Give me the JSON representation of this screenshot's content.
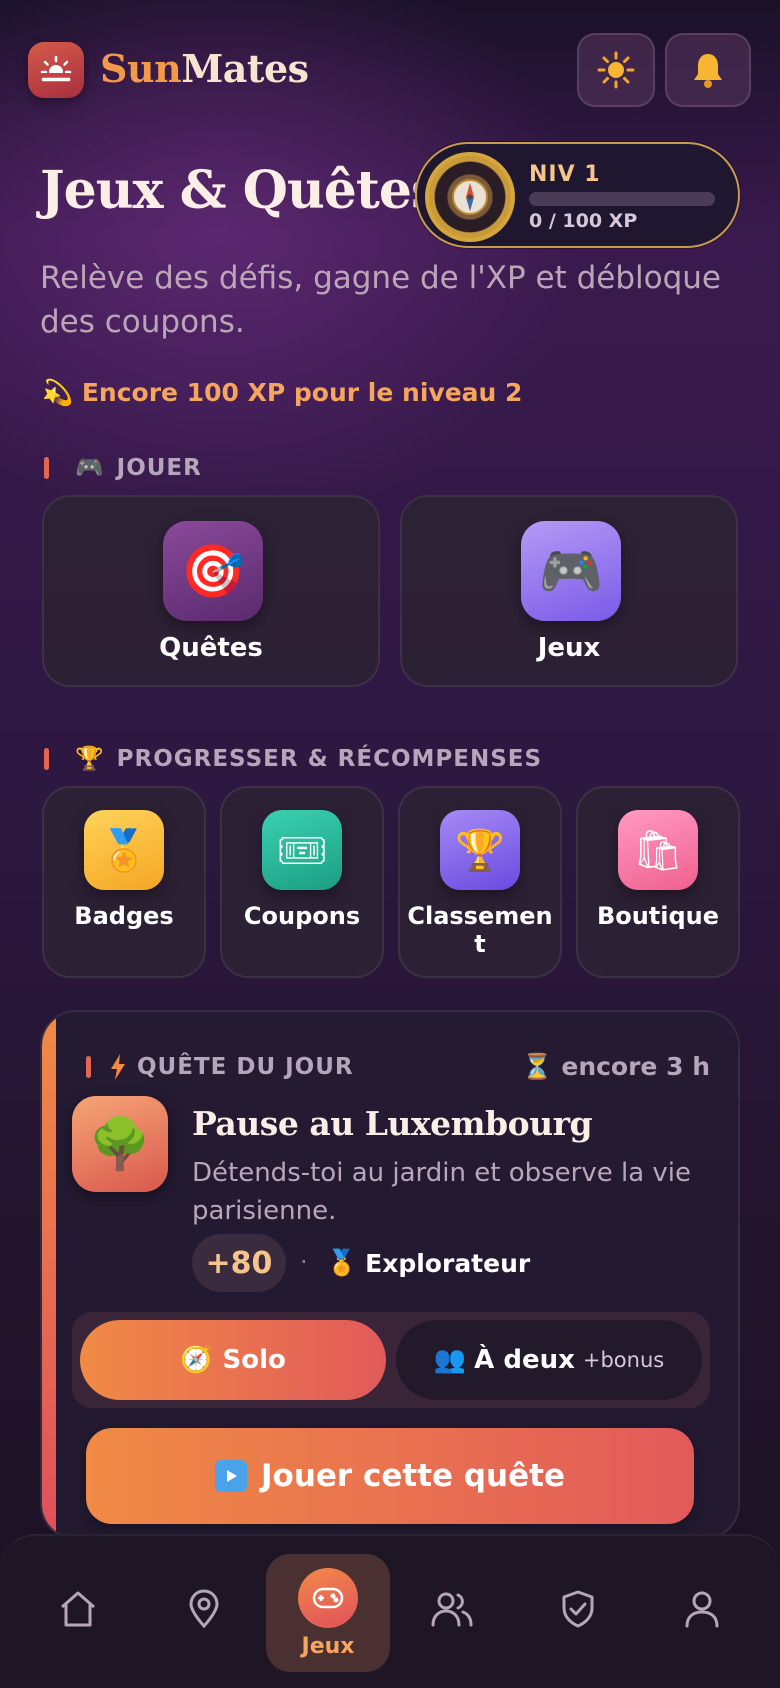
{
  "header": {
    "brand_part1": "Sun",
    "brand_part2": "Mates",
    "theme_icon": "sun-icon",
    "bell_icon": "bell-icon"
  },
  "hero": {
    "title": "Jeux & Quêtes",
    "subtitle": "Relève des défis, gagne de l'XP et débloque des coupons.",
    "xp_hint_icon": "💫",
    "xp_hint": "Encore 100 XP pour le niveau 2"
  },
  "level": {
    "label": "NIV 1",
    "xp_text": "0 / 100 XP",
    "progress": 0
  },
  "play_section": {
    "icon": "🎮",
    "title": "JOUER",
    "cards": [
      {
        "label": "Quêtes",
        "emoji": "🎯"
      },
      {
        "label": "Jeux",
        "emoji": "🎮"
      }
    ]
  },
  "rewards_section": {
    "icon": "🏆",
    "title": "PROGRESSER & RÉCOMPENSES",
    "cards": [
      {
        "label": "Badges",
        "emoji": "🏅"
      },
      {
        "label": "Coupons",
        "emoji": "🎟"
      },
      {
        "label": "Classement",
        "emoji": "🏆"
      },
      {
        "label": "Boutique",
        "emoji": "🛍"
      }
    ]
  },
  "quest": {
    "header": "QUÊTE DU JOUR",
    "time_icon": "⏳",
    "time_left": "encore 3 h",
    "emoji": "🌳",
    "title": "Pause au Luxembourg",
    "description": "Détends-toi au jardin et observe la vie parisienne.",
    "xp": "+80",
    "separator": "·",
    "badge_icon": "🏅",
    "badge": "Explorateur",
    "mode_solo_icon": "🧭",
    "mode_solo": "Solo",
    "mode_duo_icon": "👥",
    "mode_duo": "À deux",
    "mode_duo_bonus": "+bonus",
    "play_label": "Jouer cette quête"
  },
  "nav": {
    "active_label": "Jeux",
    "items": [
      "home-icon",
      "map-pin-icon",
      "gamepad-icon",
      "friends-icon",
      "shield-check-icon",
      "profile-icon"
    ]
  },
  "colors": {
    "accent_orange": "#f08a45",
    "accent_red": "#e25a5a",
    "gold": "#d4a63c"
  }
}
